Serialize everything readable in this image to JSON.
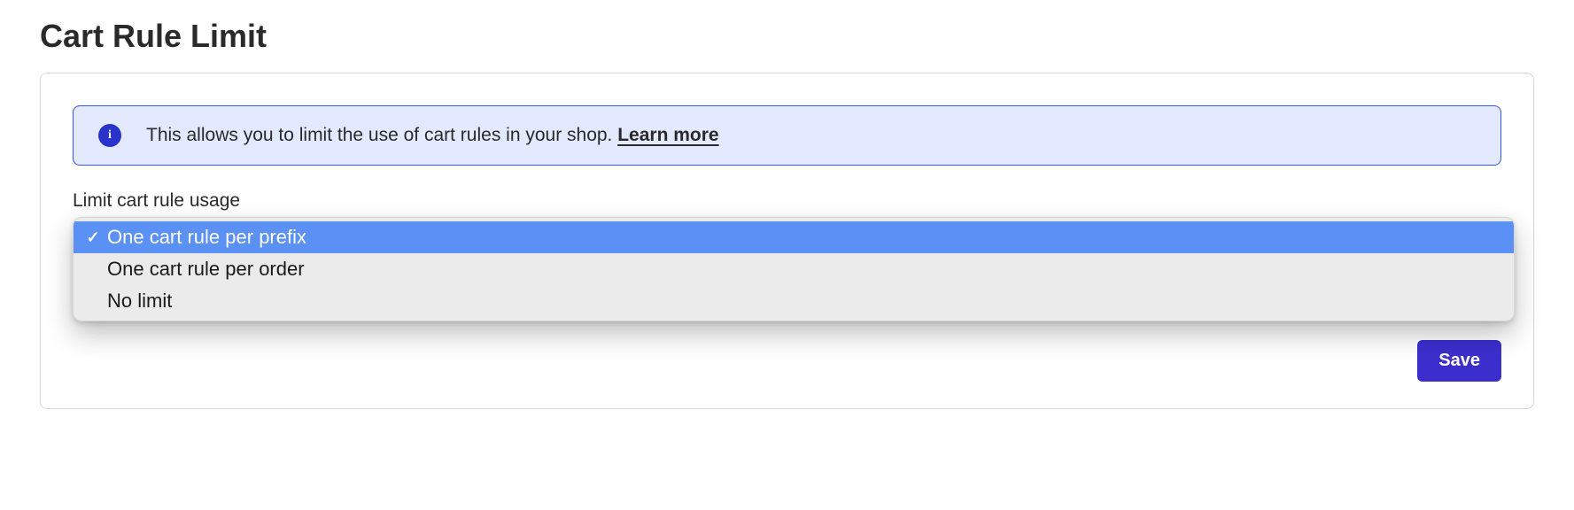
{
  "page": {
    "title": "Cart Rule Limit"
  },
  "banner": {
    "text": "This allows you to limit the use of cart rules in your shop. ",
    "learn_more": "Learn more"
  },
  "field": {
    "label": "Limit cart rule usage",
    "options": [
      {
        "label": "One cart rule per prefix",
        "selected": true
      },
      {
        "label": "One cart rule per order",
        "selected": false
      },
      {
        "label": "No limit",
        "selected": false
      }
    ]
  },
  "actions": {
    "save": "Save"
  }
}
